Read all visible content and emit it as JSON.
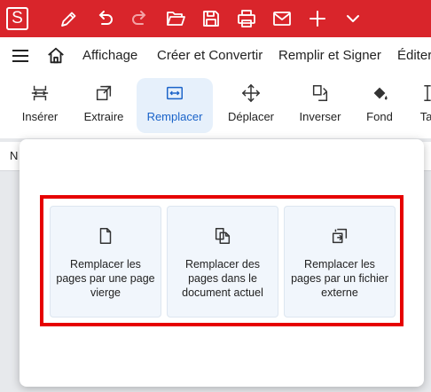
{
  "titlebar": {
    "logo_letter": "S",
    "icons": [
      "pen-icon",
      "undo-icon",
      "redo-icon",
      "folder-open-icon",
      "save-icon",
      "print-icon",
      "mail-icon",
      "plus-icon",
      "chevron-down-icon"
    ]
  },
  "menubar": {
    "items": [
      "Affichage",
      "Créer et Convertir",
      "Remplir et Signer",
      "Éditer"
    ]
  },
  "ribbon": {
    "buttons": [
      "Insérer",
      "Extraire",
      "Remplacer",
      "Déplacer",
      "Inverser",
      "Fond",
      "Tai"
    ],
    "active": "Remplacer"
  },
  "doc_strip_text": "N",
  "popup": {
    "cards": [
      "Remplacer les pages par une page vierge",
      "Remplacer des pages dans le document actuel",
      "Remplacer les pages par un fichier externe"
    ]
  },
  "colors": {
    "brand": "#d9252b",
    "accent": "#1a63c9",
    "highlight": "#e60000"
  }
}
